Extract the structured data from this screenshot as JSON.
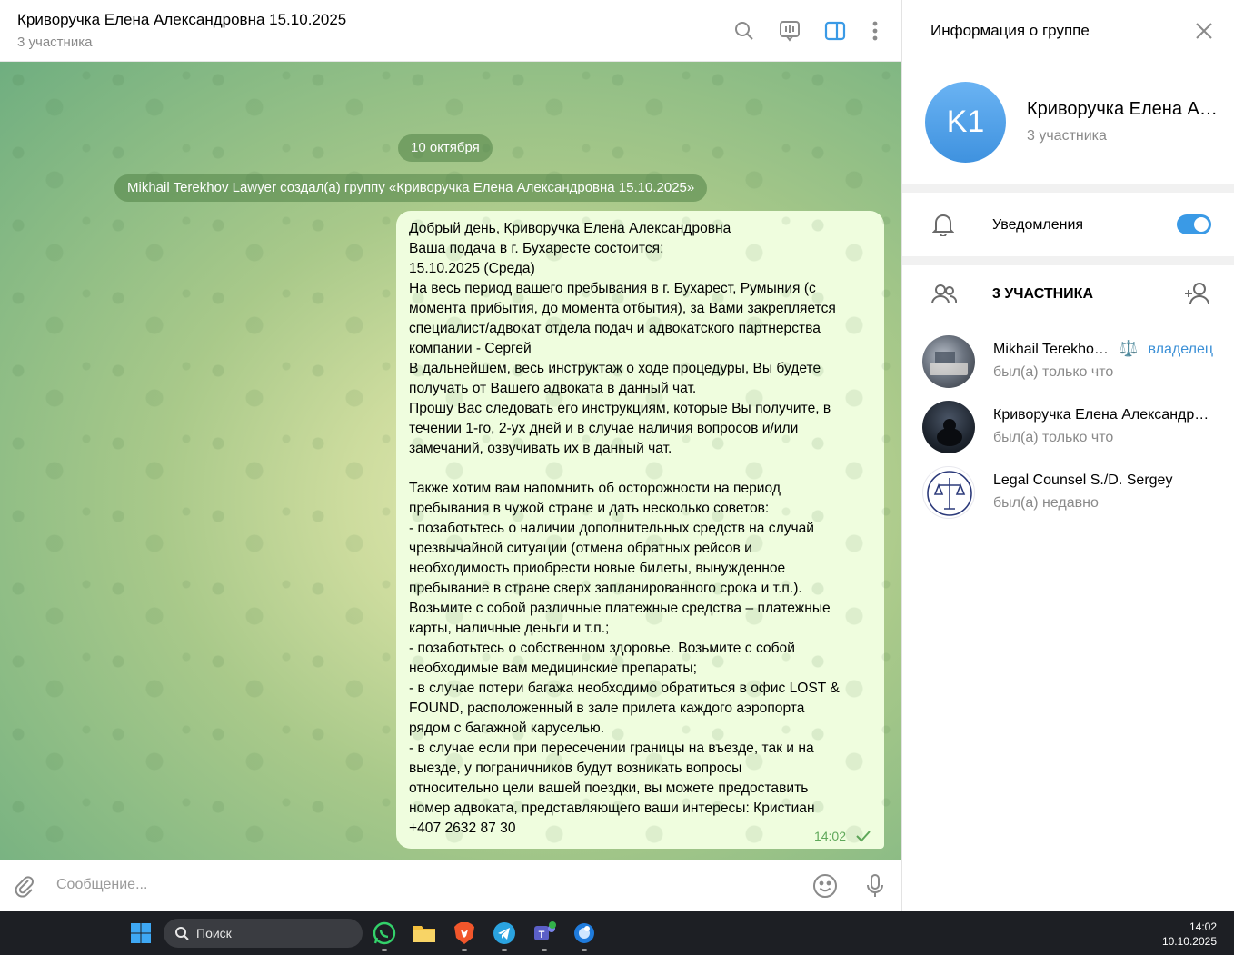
{
  "chat": {
    "title": "Криворучка Елена Александровна 15.10.2025",
    "subtitle": "3 участника",
    "date_label": "10 октября",
    "service_message": "Mikhail Terekhov Lawyer создал(а) группу «Криворучка Елена Александровна 15.10.2025»",
    "message": {
      "lines": [
        "Добрый день, Криворучка Елена Александровна",
        "Ваша подача в г. Бухаресте состоится:",
        "15.10.2025 (Среда)",
        "На весь период вашего пребывания в г. Бухарест, Румыния (с",
        "момента прибытия, до момента отбытия), за Вами закрепляется",
        "специалист/адвокат отдела подач и адвокатского партнерства",
        "компании - Сергей",
        "В дальнейшем, весь инструктаж о ходе процедуры, Вы будете",
        "получать от Вашего адвоката в данный чат.",
        "Прошу Вас следовать его инструкциям, которые Вы получите, в",
        "течении 1-го, 2-ух дней и в случае наличия вопросов и/или",
        "замечаний, озвучивать их в данный чат.",
        "",
        "Также хотим вам напомнить об осторожности на период",
        "пребывания в чужой стране и дать несколько советов:",
        "- позаботьтесь о наличии дополнительных средств на случай",
        "чрезвычайной ситуации (отмена обратных рейсов и",
        "необходимость приобрести новые билеты, вынужденное",
        "пребывание в стране сверх запланированного срока и т.п.).",
        "Возьмите с собой различные платежные средства – платежные",
        "карты, наличные деньги и т.п.;",
        "- позаботьтесь о собственном здоровье. Возьмите с собой",
        "необходимые вам медицинские препараты;",
        "- в случае потери багажа необходимо обратиться в офис LOST &",
        "FOUND, расположенный в зале прилета каждого аэропорта",
        "рядом с багажной каруселью.",
        "- в случае если при пересечении границы на въезде, так и на",
        "выезде, у пограничников будут возникать вопросы",
        "относительно цели вашей поездки, вы можете предоставить",
        "номер адвоката, представляющего ваши интересы: Кристиан",
        "+407 2632 87 30"
      ],
      "time": "14:02"
    },
    "composer_placeholder": "Сообщение..."
  },
  "panel": {
    "title": "Информация о группе",
    "group_initials": "K1",
    "group_name": "Криворучка Елена Александровна 15.10.2025",
    "group_subtitle": "3 участника",
    "notifications_label": "Уведомления",
    "notifications_on": true,
    "members_header": "3 УЧАСТНИКА",
    "members": [
      {
        "name": "Mikhail Terekhov Lawyer",
        "emoji": "⚖️",
        "role": "владелец",
        "status": "был(а) только что"
      },
      {
        "name": "Криворучка Елена Александровна",
        "status": "был(а) только что"
      },
      {
        "name": "Legal Counsel S./D. Sergey",
        "status": "был(а) недавно"
      }
    ]
  },
  "taskbar": {
    "search_label": "Поиск",
    "time": "14:02",
    "date": "10.10.2025"
  },
  "colors": {
    "accent": "#3a9ae6",
    "bubble": "#effdde",
    "time_green": "#5fa85a",
    "avatar_blue": "#4a9de6"
  }
}
